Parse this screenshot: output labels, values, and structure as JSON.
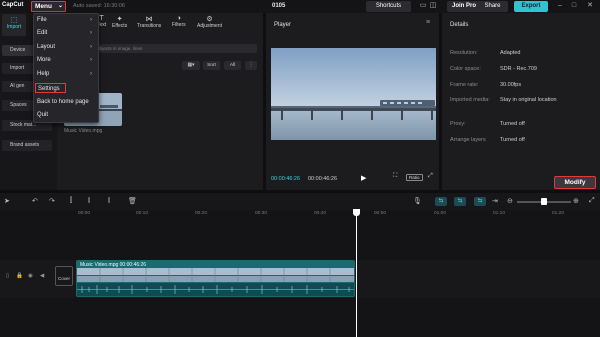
{
  "title_bar": {
    "logo": "CapCut",
    "menu_label": "Menu",
    "autosave": "Auto saved: 16:30:06",
    "project_name": "0105",
    "shortcuts": "Shortcuts",
    "join_pro": "Join Pro",
    "share": "Share",
    "export": "Export"
  },
  "left_nav": {
    "tab_import": "Import",
    "items": [
      "Device",
      "Import",
      "AI gen",
      "Spaces",
      "Stock mat...",
      "Brand assets"
    ]
  },
  "media_tabs": [
    "Text",
    "Effects",
    "Transitions",
    "Filters",
    "Adjustment"
  ],
  "media": {
    "search_placeholder": "Search subjects in image, lines",
    "sort_label": "Sort",
    "all_label": "All",
    "item_name": "Music Video.mpg"
  },
  "dropdown": {
    "items": [
      {
        "label": "File",
        "has_sub": true
      },
      {
        "label": "Edit",
        "has_sub": true
      },
      {
        "label": "Layout",
        "has_sub": true
      },
      {
        "label": "More",
        "has_sub": true
      },
      {
        "label": "Help",
        "has_sub": true
      },
      {
        "label": "Settings",
        "has_sub": false
      },
      {
        "label": "Back to home page",
        "has_sub": false
      },
      {
        "label": "Quit",
        "has_sub": false
      }
    ]
  },
  "player": {
    "title": "Player",
    "time_current": "00:00:46:26",
    "time_total": "00:00:46:26",
    "ratio_label": "Ratio"
  },
  "details": {
    "title": "Details",
    "rows": [
      {
        "label": "Resolution:",
        "value": "Adapted"
      },
      {
        "label": "Color space:",
        "value": "SDR - Rec.709"
      },
      {
        "label": "Frame rate:",
        "value": "30.00fps"
      },
      {
        "label": "Imported media:",
        "value": "Stay in original location"
      },
      {
        "label": "Proxy:",
        "value": "Turned off"
      },
      {
        "label": "Arrange layers",
        "value": "Turned off"
      }
    ],
    "modify": "Modify"
  },
  "timeline": {
    "ticks": [
      "00:00",
      "00:10",
      "00:20",
      "00:30",
      "00:40",
      "00:50",
      "01:00",
      "01:10",
      "01:20"
    ],
    "clip_label": "Music Video.mpg  00:00:46:26",
    "cover_label": "Cover"
  },
  "colors": {
    "accent": "#2fc4d0",
    "highlight_border": "#e03a3a",
    "clip": "#1c6a70"
  }
}
